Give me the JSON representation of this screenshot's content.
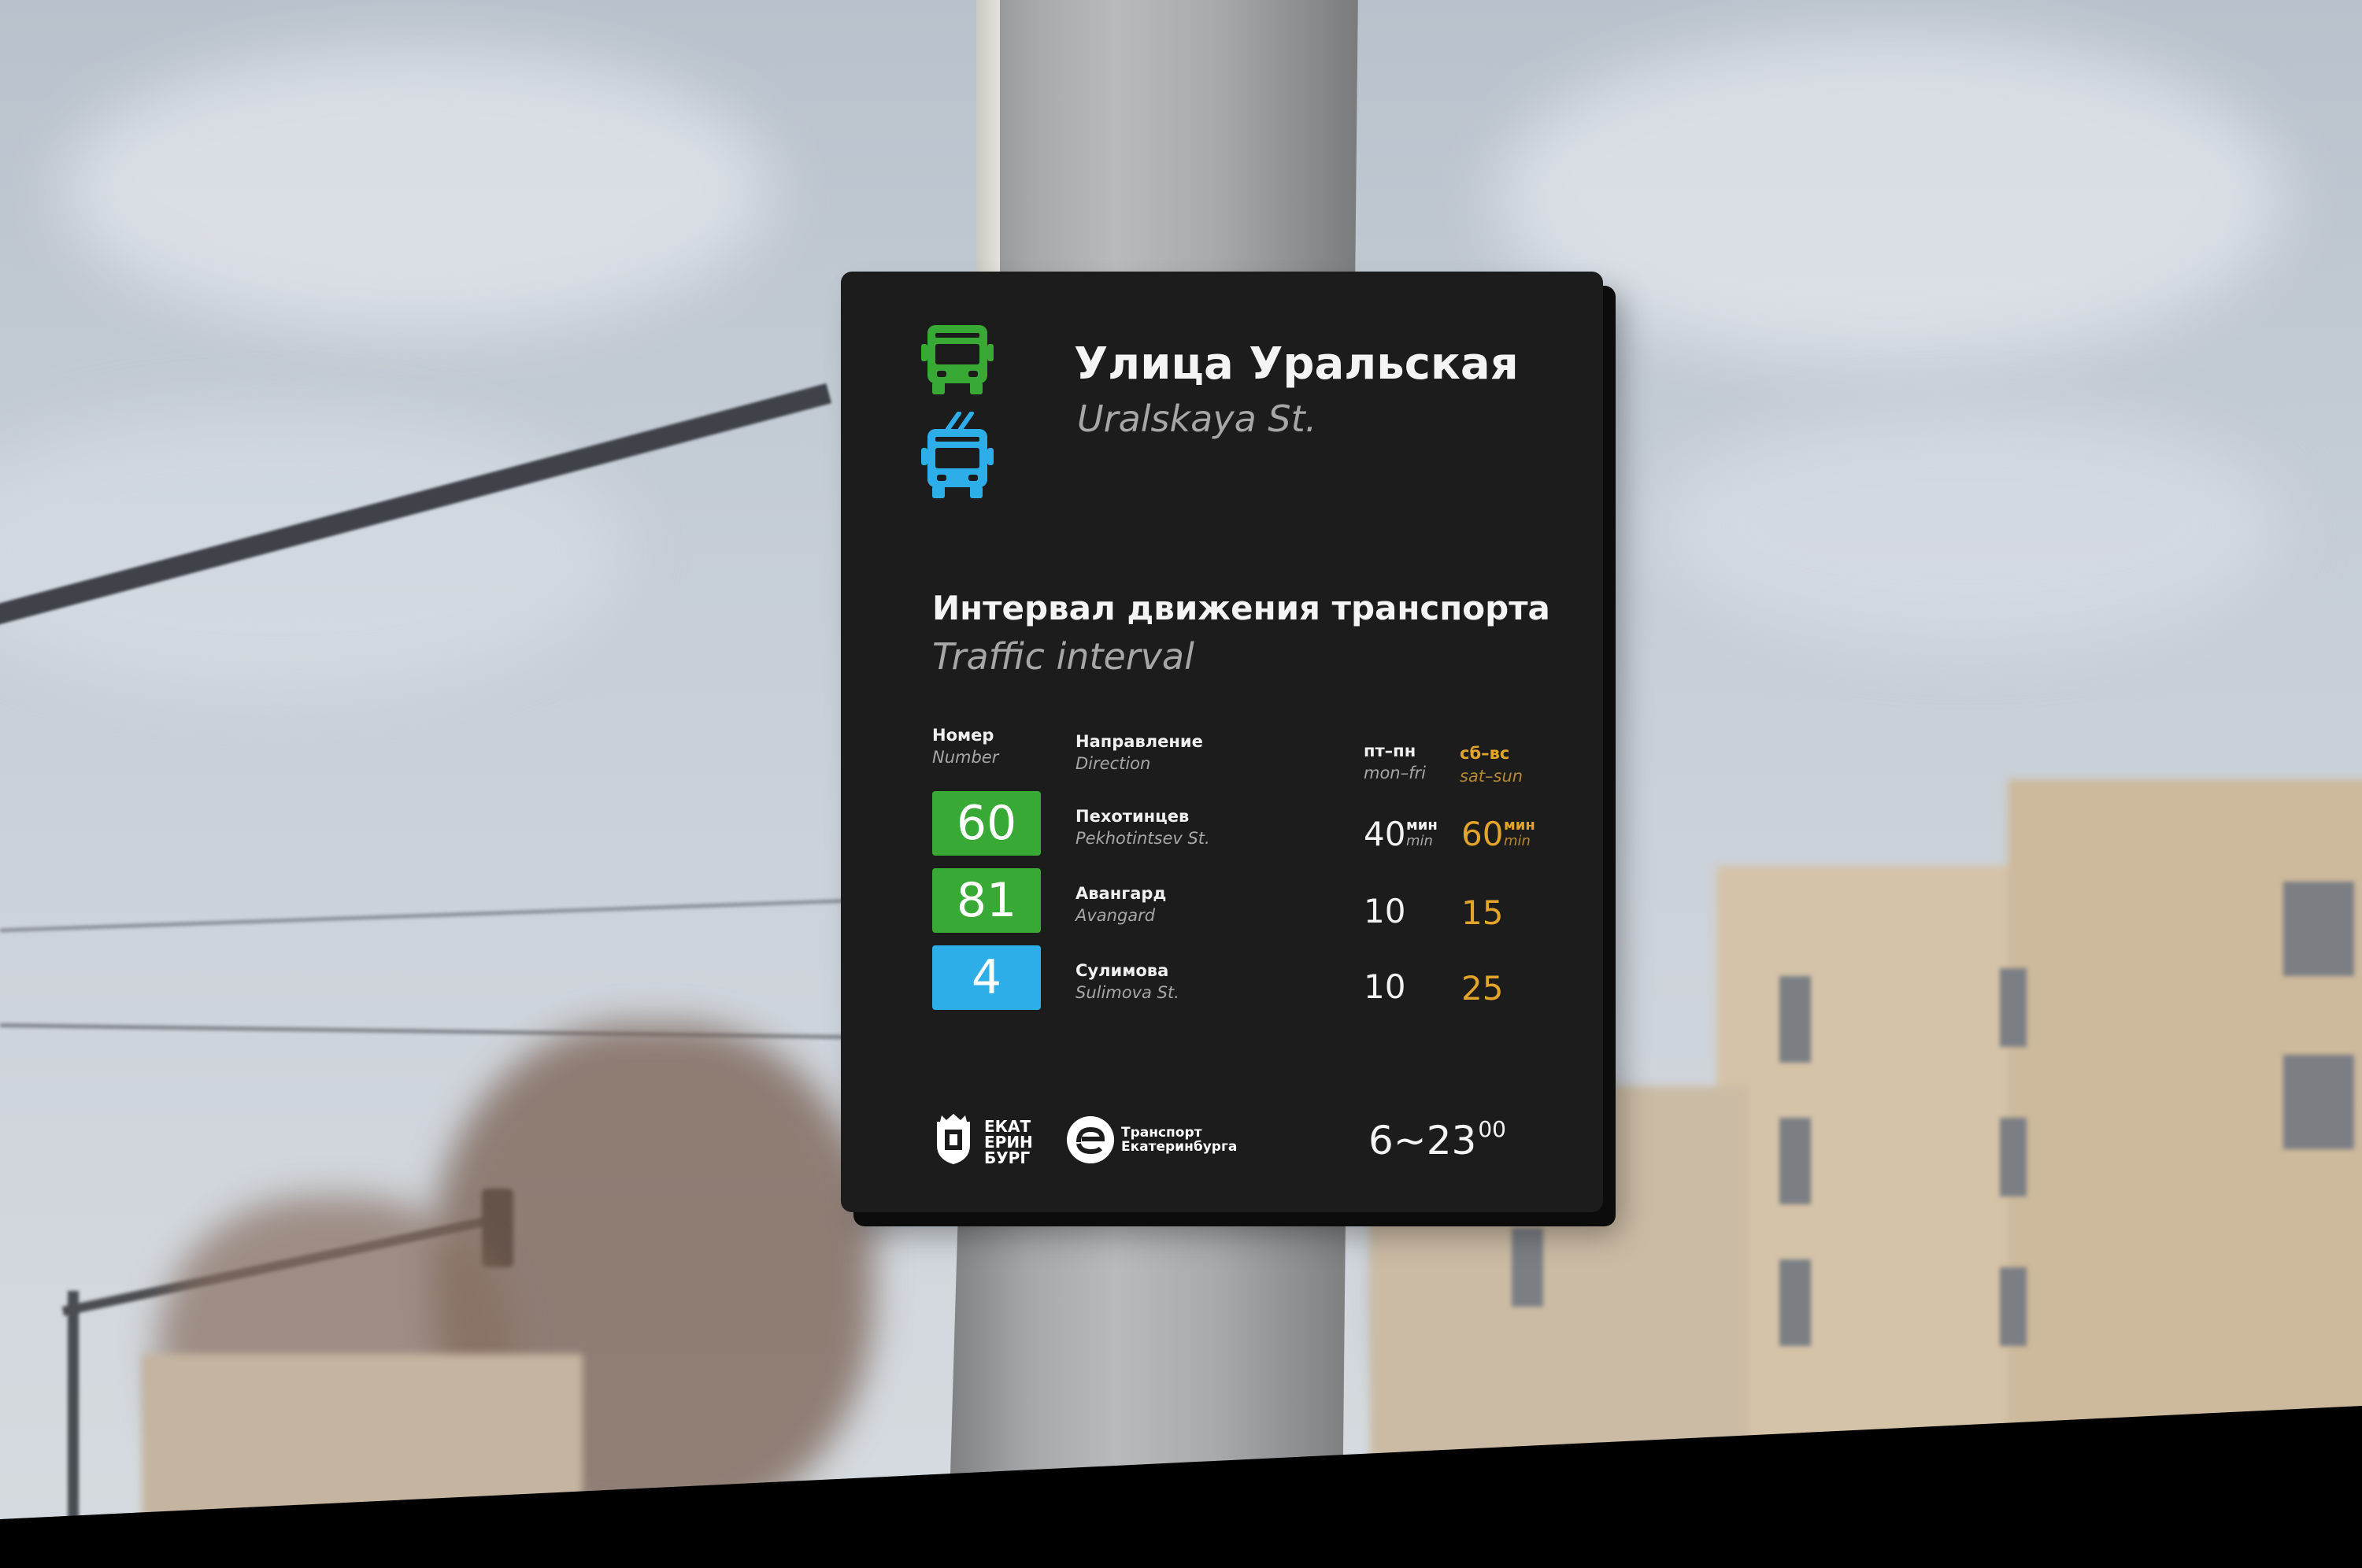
{
  "sign": {
    "stop_name_ru": "Улица Уральская",
    "stop_name_en": "Uralskaya St.",
    "section_title_ru": "Интервал движения транспорта",
    "section_title_en": "Traffic interval",
    "headers": {
      "number_ru": "Номер",
      "number_en": "Number",
      "direction_ru": "Направление",
      "direction_en": "Direction",
      "weekdays_ru": "пт–пн",
      "weekdays_en": "mon–fri",
      "weekend_ru": "сб–вс",
      "weekend_en": "sat–sun"
    },
    "unit_ru": "мин",
    "unit_en": "min",
    "routes": [
      {
        "number": "60",
        "type": "bus",
        "color": "#39a935",
        "direction_ru": "Пехотинцев",
        "direction_en": "Pekhotintsev St.",
        "weekday_interval": "40",
        "weekend_interval": "60"
      },
      {
        "number": "81",
        "type": "bus",
        "color": "#39a935",
        "direction_ru": "Авангард",
        "direction_en": "Avangard",
        "weekday_interval": "10",
        "weekend_interval": "15"
      },
      {
        "number": "4",
        "type": "trolleybus",
        "color": "#2eaee8",
        "direction_ru": "Сулимова",
        "direction_en": "Sulimova St.",
        "weekday_interval": "10",
        "weekend_interval": "25"
      }
    ],
    "hours_main": "6~23",
    "hours_minutes": "00",
    "logo_city_lines": [
      "ЕКАТ",
      "ЕРИН",
      "БУРГ"
    ],
    "logo_transport_lines": [
      "Транспорт",
      "Екатеринбурга"
    ],
    "icons": [
      "bus-icon",
      "trolleybus-icon",
      "city-coat-of-arms-icon",
      "transport-logo-icon"
    ],
    "colors": {
      "bus": "#39a935",
      "trolleybus": "#2eaee8",
      "accent": "#e3a42c",
      "panel": "#1c1c1d"
    }
  }
}
